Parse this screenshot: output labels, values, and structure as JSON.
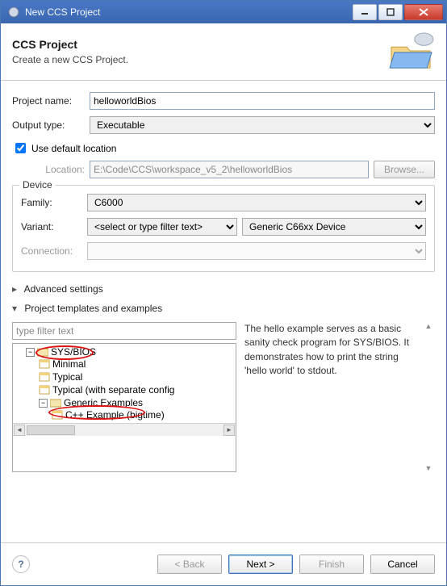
{
  "window": {
    "title": "New CCS Project"
  },
  "header": {
    "title": "CCS Project",
    "subtitle": "Create a new CCS Project."
  },
  "labels": {
    "project_name": "Project name:",
    "output_type": "Output type:",
    "use_default_location": "Use default location",
    "location": "Location:",
    "browse": "Browse...",
    "device_legend": "Device",
    "family": "Family:",
    "variant": "Variant:",
    "connection": "Connection:",
    "advanced": "Advanced settings",
    "templates_section": "Project templates and examples",
    "filter_placeholder": "type filter text"
  },
  "values": {
    "project_name": "helloworldBios",
    "output_type": "Executable",
    "location": "E:\\Code\\CCS\\workspace_v5_2\\helloworldBios",
    "family": "C6000",
    "variant_filter": "<select or type filter text>",
    "variant_device": "Generic C66xx Device",
    "connection": ""
  },
  "tree": {
    "root": "SYS/BIOS",
    "items": [
      "Minimal",
      "Typical",
      "Typical (with separate config",
      "Generic Examples"
    ],
    "sub": "C++ Example (bigtime)"
  },
  "description": "The hello example serves as a basic sanity check program for SYS/BIOS. It demonstrates how to print the string 'hello world' to stdout.",
  "footer": {
    "back": "< Back",
    "next": "Next >",
    "finish": "Finish",
    "cancel": "Cancel"
  }
}
